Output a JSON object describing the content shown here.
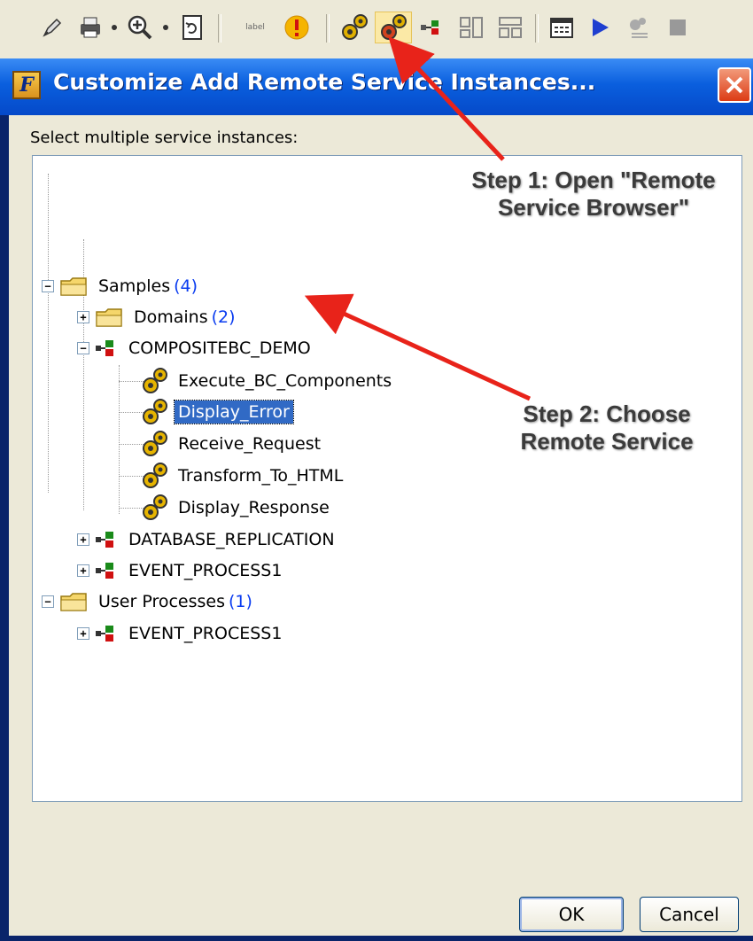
{
  "dialog": {
    "title": "Customize Add Remote Service Instances...",
    "prompt": "Select multiple service instances:",
    "ok_label": "OK",
    "cancel_label": "Cancel"
  },
  "toolbar": {
    "items": [
      "pen-icon",
      "print-icon",
      "zoom-icon",
      "refresh-icon",
      "label-icon",
      "warning-icon",
      "services-icon",
      "remote-service-browser-icon",
      "process-icon",
      "layout-icon",
      "layout-icon-2",
      "calendar-icon",
      "play-icon",
      "debug-icon",
      "stop-icon"
    ],
    "active_item": "remote-service-browser-icon",
    "label_icon_text": "label"
  },
  "tree": {
    "samples": {
      "label": "Samples",
      "count": "(4)"
    },
    "domains": {
      "label": "Domains",
      "count": "(2)"
    },
    "compositebc": {
      "label": "COMPOSITEBC_DEMO"
    },
    "execute": {
      "label": "Execute_BC_Components"
    },
    "display_error": {
      "label": "Display_Error",
      "selected": true
    },
    "receive": {
      "label": "Receive_Request"
    },
    "transform": {
      "label": "Transform_To_HTML"
    },
    "display_response": {
      "label": "Display_Response"
    },
    "database": {
      "label": "DATABASE_REPLICATION"
    },
    "event1": {
      "label": "EVENT_PROCESS1"
    },
    "user_processes": {
      "label": "User Processes",
      "count": "(1)"
    },
    "event2": {
      "label": "EVENT_PROCESS1"
    }
  },
  "annotations": {
    "step1_line1": "Step 1: Open \"Remote",
    "step1_line2": "Service Browser\"",
    "step2_line1": "Step 2: Choose",
    "step2_line2": "Remote Service"
  },
  "colors": {
    "arrow": "#e8231a",
    "title_bar": "#0a5fde",
    "selection": "#316ac5",
    "count": "#0a3cf0"
  }
}
